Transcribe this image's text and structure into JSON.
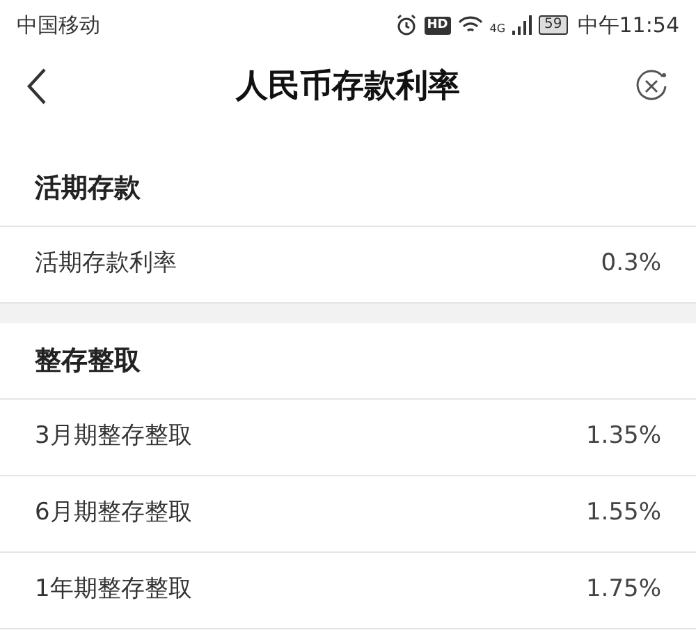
{
  "status_bar": {
    "carrier": "中国移动",
    "hd": "HD",
    "network": "4G",
    "battery": "59",
    "time": "中午11:54"
  },
  "nav": {
    "title": "人民币存款利率"
  },
  "sections": [
    {
      "title": "活期存款",
      "rows": [
        {
          "label": "活期存款利率",
          "value": "0.3%"
        }
      ]
    },
    {
      "title": "整存整取",
      "rows": [
        {
          "label": "3月期整存整取",
          "value": "1.35%"
        },
        {
          "label": "6月期整存整取",
          "value": "1.55%"
        },
        {
          "label": "1年期整存整取",
          "value": "1.75%"
        }
      ]
    }
  ]
}
